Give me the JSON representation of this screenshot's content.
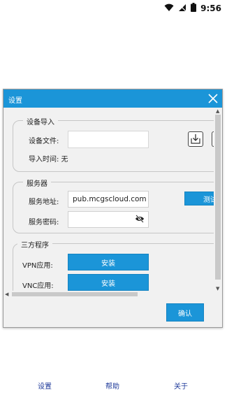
{
  "status_bar": {
    "time": "9:56"
  },
  "dialog": {
    "title": "设置",
    "device_import": {
      "legend": "设备导入",
      "file_label": "设备文件:",
      "file_value": "",
      "time_label": "导入时间: 无"
    },
    "server": {
      "legend": "服务器",
      "address_label": "服务地址:",
      "address_value": "pub.mcgscloud.com",
      "password_label": "服务密码:",
      "password_value": "",
      "test_button": "测试"
    },
    "third_party": {
      "legend": "三方程序",
      "vpn_label": "VPN应用:",
      "vpn_button": "安装",
      "vnc_label": "VNC应用:",
      "vnc_button": "安装"
    },
    "ok_button": "确认"
  },
  "bottom_nav": [
    {
      "label": "设置"
    },
    {
      "label": "帮助"
    },
    {
      "label": "关于"
    }
  ],
  "colors": {
    "accent": "#1b95d8",
    "nav_text": "#1f3a9a"
  }
}
